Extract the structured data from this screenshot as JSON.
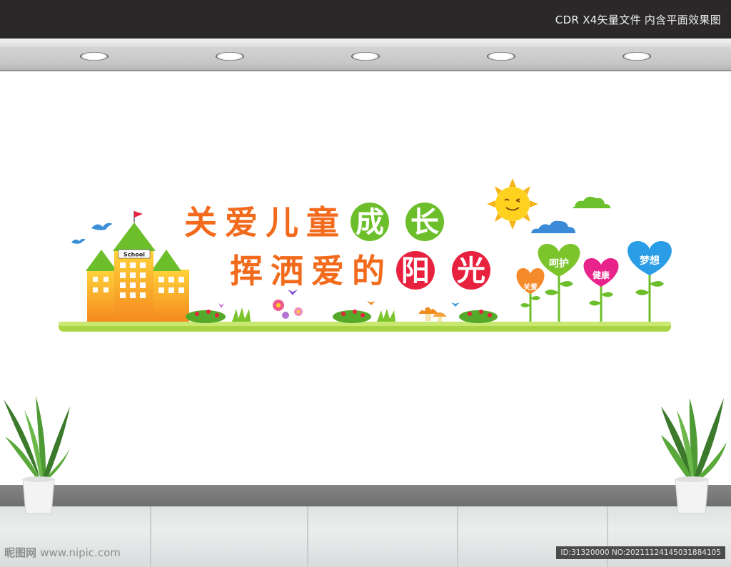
{
  "header": {
    "caption": "CDR X4矢量文件  内含平面效果图"
  },
  "mural": {
    "title_line1": [
      "关",
      "爱",
      "儿",
      "童"
    ],
    "title_line1_circled": [
      "成",
      "长"
    ],
    "title_line2": [
      "挥",
      "洒",
      "爱",
      "的"
    ],
    "title_line2_circled": [
      "阳",
      "光"
    ],
    "school_sign": "School",
    "hearts": [
      "关爱",
      "呵护",
      "健康",
      "梦想"
    ]
  },
  "colors": {
    "title_orange": "#f26b1d",
    "circle_green": "#6cbf2a",
    "circle_red": "#e8213f",
    "shelf_green": "#b5dd4e",
    "heart_orange": "#f58a2a",
    "heart_green": "#7cc42c",
    "heart_pink": "#e8238a",
    "heart_blue": "#2a9de6"
  },
  "watermark": {
    "site_logo": "昵图网",
    "site_url": "www.nipic.com",
    "id_text": "ID:31320000 NO:20211124145031884105"
  }
}
